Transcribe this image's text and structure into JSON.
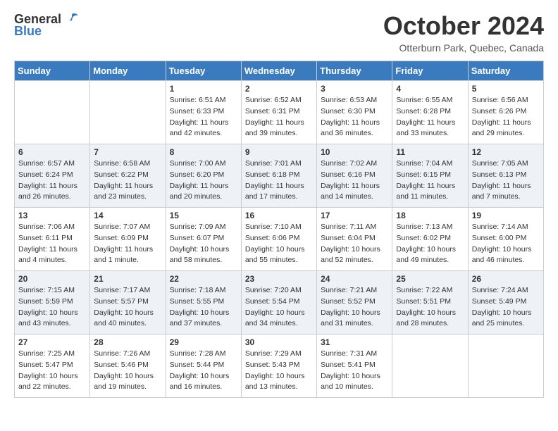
{
  "header": {
    "logo_general": "General",
    "logo_blue": "Blue",
    "month_title": "October 2024",
    "location": "Otterburn Park, Quebec, Canada"
  },
  "days_of_week": [
    "Sunday",
    "Monday",
    "Tuesday",
    "Wednesday",
    "Thursday",
    "Friday",
    "Saturday"
  ],
  "weeks": [
    [
      {
        "day": "",
        "sunrise": "",
        "sunset": "",
        "daylight": ""
      },
      {
        "day": "",
        "sunrise": "",
        "sunset": "",
        "daylight": ""
      },
      {
        "day": "1",
        "sunrise": "Sunrise: 6:51 AM",
        "sunset": "Sunset: 6:33 PM",
        "daylight": "Daylight: 11 hours and 42 minutes."
      },
      {
        "day": "2",
        "sunrise": "Sunrise: 6:52 AM",
        "sunset": "Sunset: 6:31 PM",
        "daylight": "Daylight: 11 hours and 39 minutes."
      },
      {
        "day": "3",
        "sunrise": "Sunrise: 6:53 AM",
        "sunset": "Sunset: 6:30 PM",
        "daylight": "Daylight: 11 hours and 36 minutes."
      },
      {
        "day": "4",
        "sunrise": "Sunrise: 6:55 AM",
        "sunset": "Sunset: 6:28 PM",
        "daylight": "Daylight: 11 hours and 33 minutes."
      },
      {
        "day": "5",
        "sunrise": "Sunrise: 6:56 AM",
        "sunset": "Sunset: 6:26 PM",
        "daylight": "Daylight: 11 hours and 29 minutes."
      }
    ],
    [
      {
        "day": "6",
        "sunrise": "Sunrise: 6:57 AM",
        "sunset": "Sunset: 6:24 PM",
        "daylight": "Daylight: 11 hours and 26 minutes."
      },
      {
        "day": "7",
        "sunrise": "Sunrise: 6:58 AM",
        "sunset": "Sunset: 6:22 PM",
        "daylight": "Daylight: 11 hours and 23 minutes."
      },
      {
        "day": "8",
        "sunrise": "Sunrise: 7:00 AM",
        "sunset": "Sunset: 6:20 PM",
        "daylight": "Daylight: 11 hours and 20 minutes."
      },
      {
        "day": "9",
        "sunrise": "Sunrise: 7:01 AM",
        "sunset": "Sunset: 6:18 PM",
        "daylight": "Daylight: 11 hours and 17 minutes."
      },
      {
        "day": "10",
        "sunrise": "Sunrise: 7:02 AM",
        "sunset": "Sunset: 6:16 PM",
        "daylight": "Daylight: 11 hours and 14 minutes."
      },
      {
        "day": "11",
        "sunrise": "Sunrise: 7:04 AM",
        "sunset": "Sunset: 6:15 PM",
        "daylight": "Daylight: 11 hours and 11 minutes."
      },
      {
        "day": "12",
        "sunrise": "Sunrise: 7:05 AM",
        "sunset": "Sunset: 6:13 PM",
        "daylight": "Daylight: 11 hours and 7 minutes."
      }
    ],
    [
      {
        "day": "13",
        "sunrise": "Sunrise: 7:06 AM",
        "sunset": "Sunset: 6:11 PM",
        "daylight": "Daylight: 11 hours and 4 minutes."
      },
      {
        "day": "14",
        "sunrise": "Sunrise: 7:07 AM",
        "sunset": "Sunset: 6:09 PM",
        "daylight": "Daylight: 11 hours and 1 minute."
      },
      {
        "day": "15",
        "sunrise": "Sunrise: 7:09 AM",
        "sunset": "Sunset: 6:07 PM",
        "daylight": "Daylight: 10 hours and 58 minutes."
      },
      {
        "day": "16",
        "sunrise": "Sunrise: 7:10 AM",
        "sunset": "Sunset: 6:06 PM",
        "daylight": "Daylight: 10 hours and 55 minutes."
      },
      {
        "day": "17",
        "sunrise": "Sunrise: 7:11 AM",
        "sunset": "Sunset: 6:04 PM",
        "daylight": "Daylight: 10 hours and 52 minutes."
      },
      {
        "day": "18",
        "sunrise": "Sunrise: 7:13 AM",
        "sunset": "Sunset: 6:02 PM",
        "daylight": "Daylight: 10 hours and 49 minutes."
      },
      {
        "day": "19",
        "sunrise": "Sunrise: 7:14 AM",
        "sunset": "Sunset: 6:00 PM",
        "daylight": "Daylight: 10 hours and 46 minutes."
      }
    ],
    [
      {
        "day": "20",
        "sunrise": "Sunrise: 7:15 AM",
        "sunset": "Sunset: 5:59 PM",
        "daylight": "Daylight: 10 hours and 43 minutes."
      },
      {
        "day": "21",
        "sunrise": "Sunrise: 7:17 AM",
        "sunset": "Sunset: 5:57 PM",
        "daylight": "Daylight: 10 hours and 40 minutes."
      },
      {
        "day": "22",
        "sunrise": "Sunrise: 7:18 AM",
        "sunset": "Sunset: 5:55 PM",
        "daylight": "Daylight: 10 hours and 37 minutes."
      },
      {
        "day": "23",
        "sunrise": "Sunrise: 7:20 AM",
        "sunset": "Sunset: 5:54 PM",
        "daylight": "Daylight: 10 hours and 34 minutes."
      },
      {
        "day": "24",
        "sunrise": "Sunrise: 7:21 AM",
        "sunset": "Sunset: 5:52 PM",
        "daylight": "Daylight: 10 hours and 31 minutes."
      },
      {
        "day": "25",
        "sunrise": "Sunrise: 7:22 AM",
        "sunset": "Sunset: 5:51 PM",
        "daylight": "Daylight: 10 hours and 28 minutes."
      },
      {
        "day": "26",
        "sunrise": "Sunrise: 7:24 AM",
        "sunset": "Sunset: 5:49 PM",
        "daylight": "Daylight: 10 hours and 25 minutes."
      }
    ],
    [
      {
        "day": "27",
        "sunrise": "Sunrise: 7:25 AM",
        "sunset": "Sunset: 5:47 PM",
        "daylight": "Daylight: 10 hours and 22 minutes."
      },
      {
        "day": "28",
        "sunrise": "Sunrise: 7:26 AM",
        "sunset": "Sunset: 5:46 PM",
        "daylight": "Daylight: 10 hours and 19 minutes."
      },
      {
        "day": "29",
        "sunrise": "Sunrise: 7:28 AM",
        "sunset": "Sunset: 5:44 PM",
        "daylight": "Daylight: 10 hours and 16 minutes."
      },
      {
        "day": "30",
        "sunrise": "Sunrise: 7:29 AM",
        "sunset": "Sunset: 5:43 PM",
        "daylight": "Daylight: 10 hours and 13 minutes."
      },
      {
        "day": "31",
        "sunrise": "Sunrise: 7:31 AM",
        "sunset": "Sunset: 5:41 PM",
        "daylight": "Daylight: 10 hours and 10 minutes."
      },
      {
        "day": "",
        "sunrise": "",
        "sunset": "",
        "daylight": ""
      },
      {
        "day": "",
        "sunrise": "",
        "sunset": "",
        "daylight": ""
      }
    ]
  ]
}
